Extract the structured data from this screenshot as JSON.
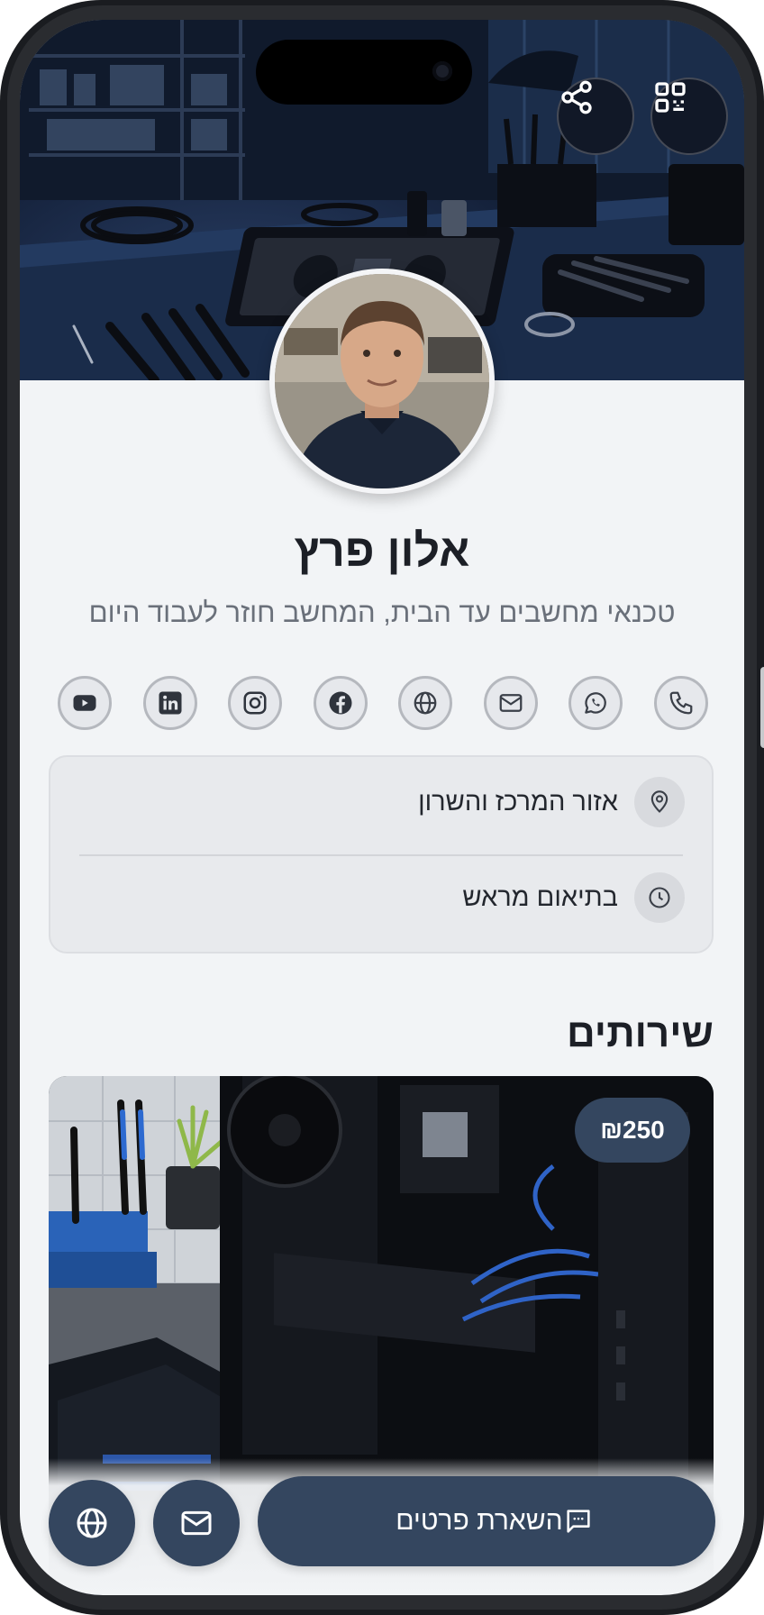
{
  "profile": {
    "name": "אלון פרץ",
    "tagline": "טכנאי מחשבים עד הבית, המחשב חוזר לעבוד היום"
  },
  "header": {
    "qr_icon": "qr-code-icon",
    "share_icon": "share-icon"
  },
  "socials": [
    {
      "name": "phone",
      "icon": "phone-icon"
    },
    {
      "name": "whatsapp",
      "icon": "whatsapp-icon"
    },
    {
      "name": "email",
      "icon": "mail-icon"
    },
    {
      "name": "website",
      "icon": "globe-icon"
    },
    {
      "name": "facebook",
      "icon": "facebook-icon"
    },
    {
      "name": "instagram",
      "icon": "instagram-icon"
    },
    {
      "name": "linkedin",
      "icon": "linkedin-icon"
    },
    {
      "name": "youtube",
      "icon": "youtube-icon"
    }
  ],
  "info": {
    "location": "אזור המרכז והשרון",
    "hours": "בתיאום מראש"
  },
  "services": {
    "title": "שירותים",
    "items": [
      {
        "price": "₪250"
      }
    ]
  },
  "actions": {
    "leave_details": "השארת פרטים"
  },
  "colors": {
    "primary": "#34465f",
    "background": "#f2f4f6",
    "text": "#1c1f26"
  }
}
